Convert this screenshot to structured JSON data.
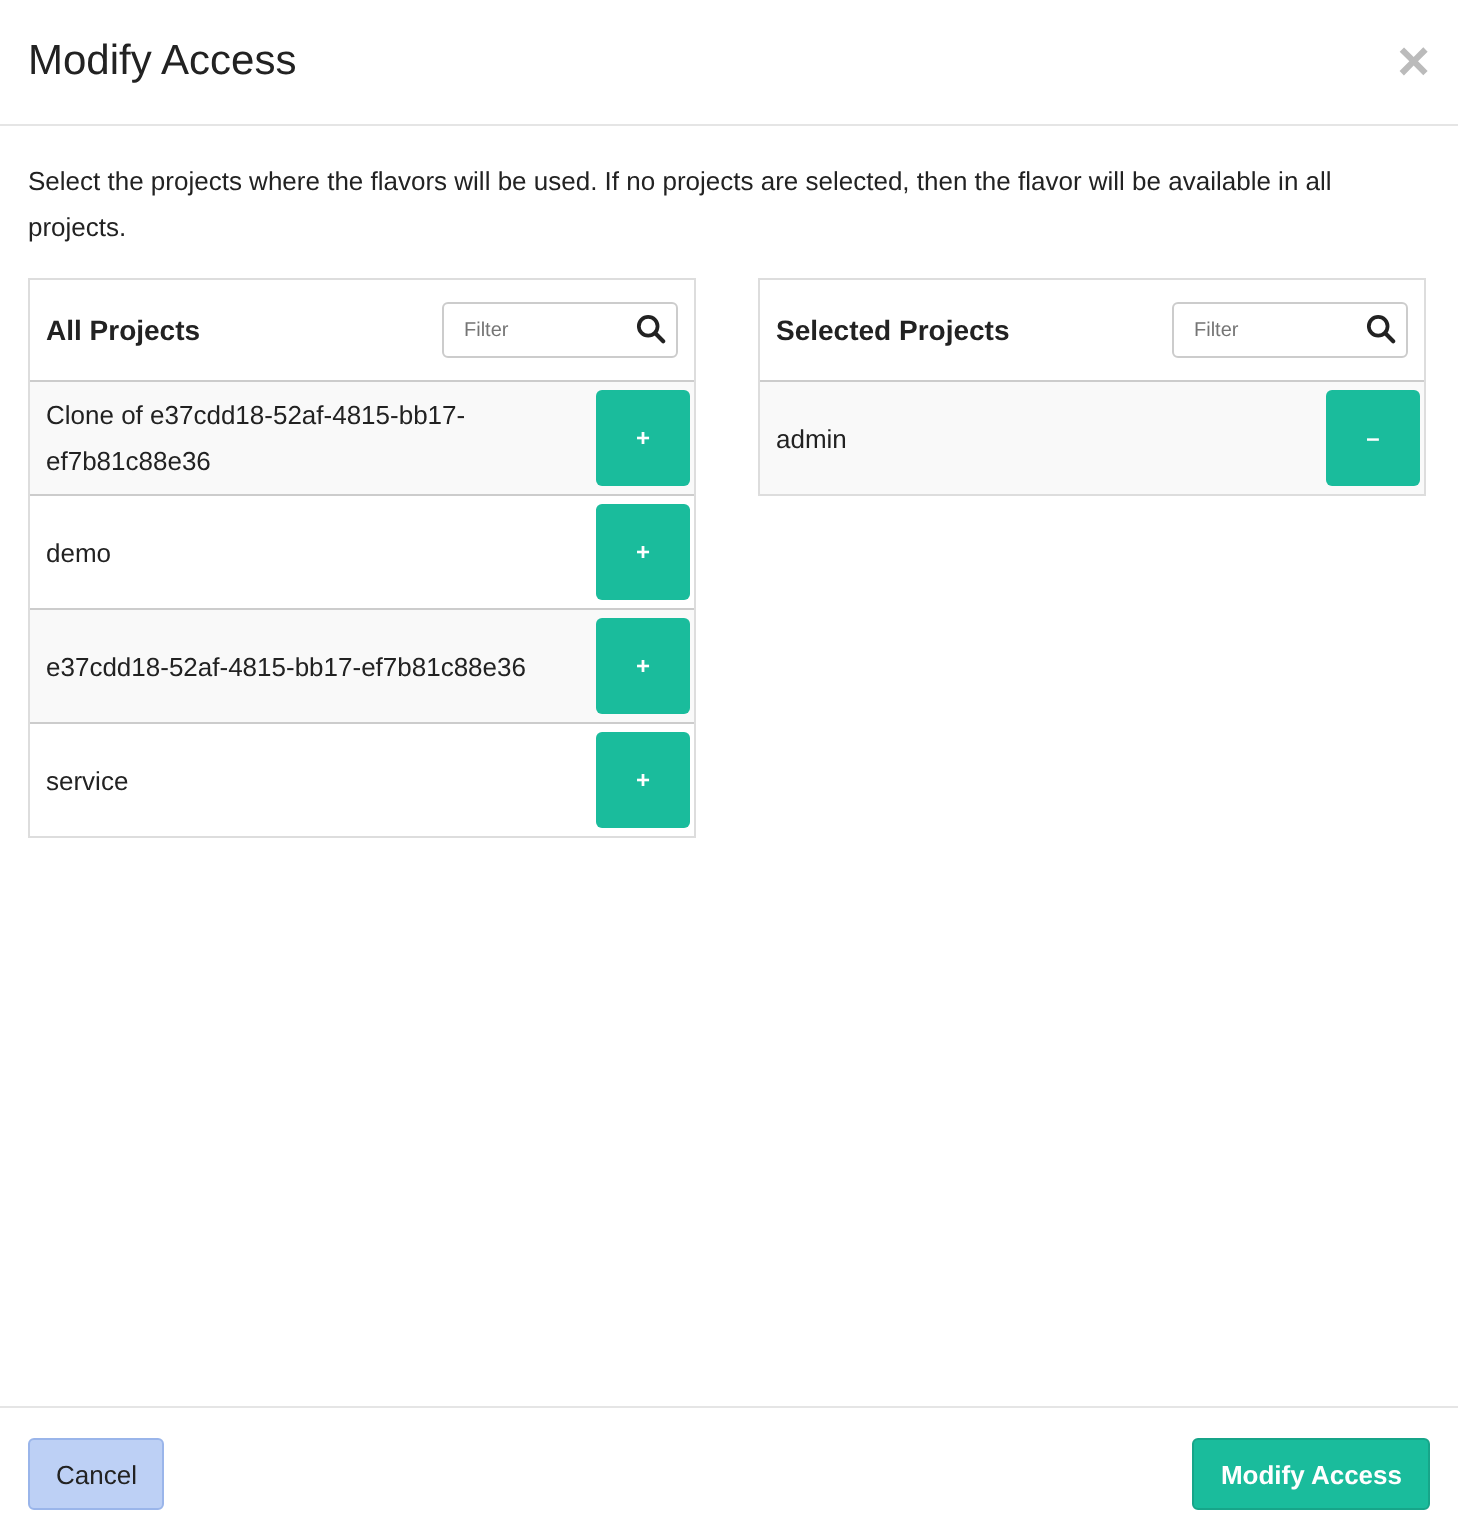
{
  "dialog": {
    "title": "Modify Access",
    "close": "×"
  },
  "description": "Select the projects where the flavors will be used. If no projects are selected, then the flavor will be available in all projects.",
  "panels": [
    {
      "title": "All Projects",
      "filter": {
        "placeholder": "Filter"
      },
      "action": "+",
      "items": [
        {
          "name": "Clone of e37cdd18-52af-4815-bb17-ef7b81c88e36"
        },
        {
          "name": "demo"
        },
        {
          "name": "e37cdd18-52af-4815-bb17-ef7b81c88e36"
        },
        {
          "name": "service"
        }
      ]
    },
    {
      "title": "Selected Projects",
      "filter": {
        "placeholder": "Filter"
      },
      "action": "–",
      "items": [
        {
          "name": "admin"
        }
      ]
    }
  ],
  "buttons": [
    {
      "label": "Cancel",
      "kind": "secondary"
    },
    {
      "label": "Modify Access",
      "kind": "primary"
    }
  ]
}
